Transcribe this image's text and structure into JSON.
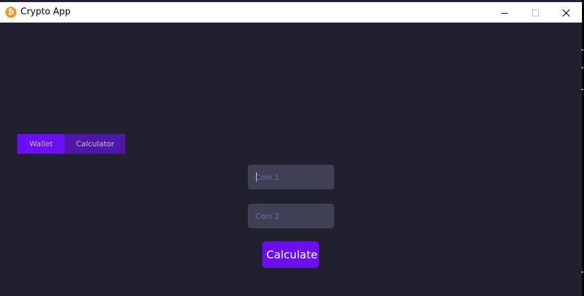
{
  "window": {
    "title": "Crypto App",
    "icon": "bitcoin-icon",
    "icon_glyph": "₿",
    "icon_color": "#f7931a",
    "controls": {
      "minimize_icon": "minimize-icon",
      "maximize_icon": "maximize-icon",
      "close_icon": "close-icon"
    }
  },
  "tabs": [
    {
      "label": "Wallet",
      "active": true
    },
    {
      "label": "Calculator",
      "active": false
    }
  ],
  "form": {
    "coin1_placeholder": "Coin 1",
    "coin1_value": "",
    "coin2_placeholder": "Coin 2",
    "coin2_value": "",
    "calculate_label": "Calculate"
  },
  "colors": {
    "background": "#20202e",
    "accent": "#6b0ef0",
    "accent_dark": "#4e17a6",
    "input_bg": "#404055"
  }
}
